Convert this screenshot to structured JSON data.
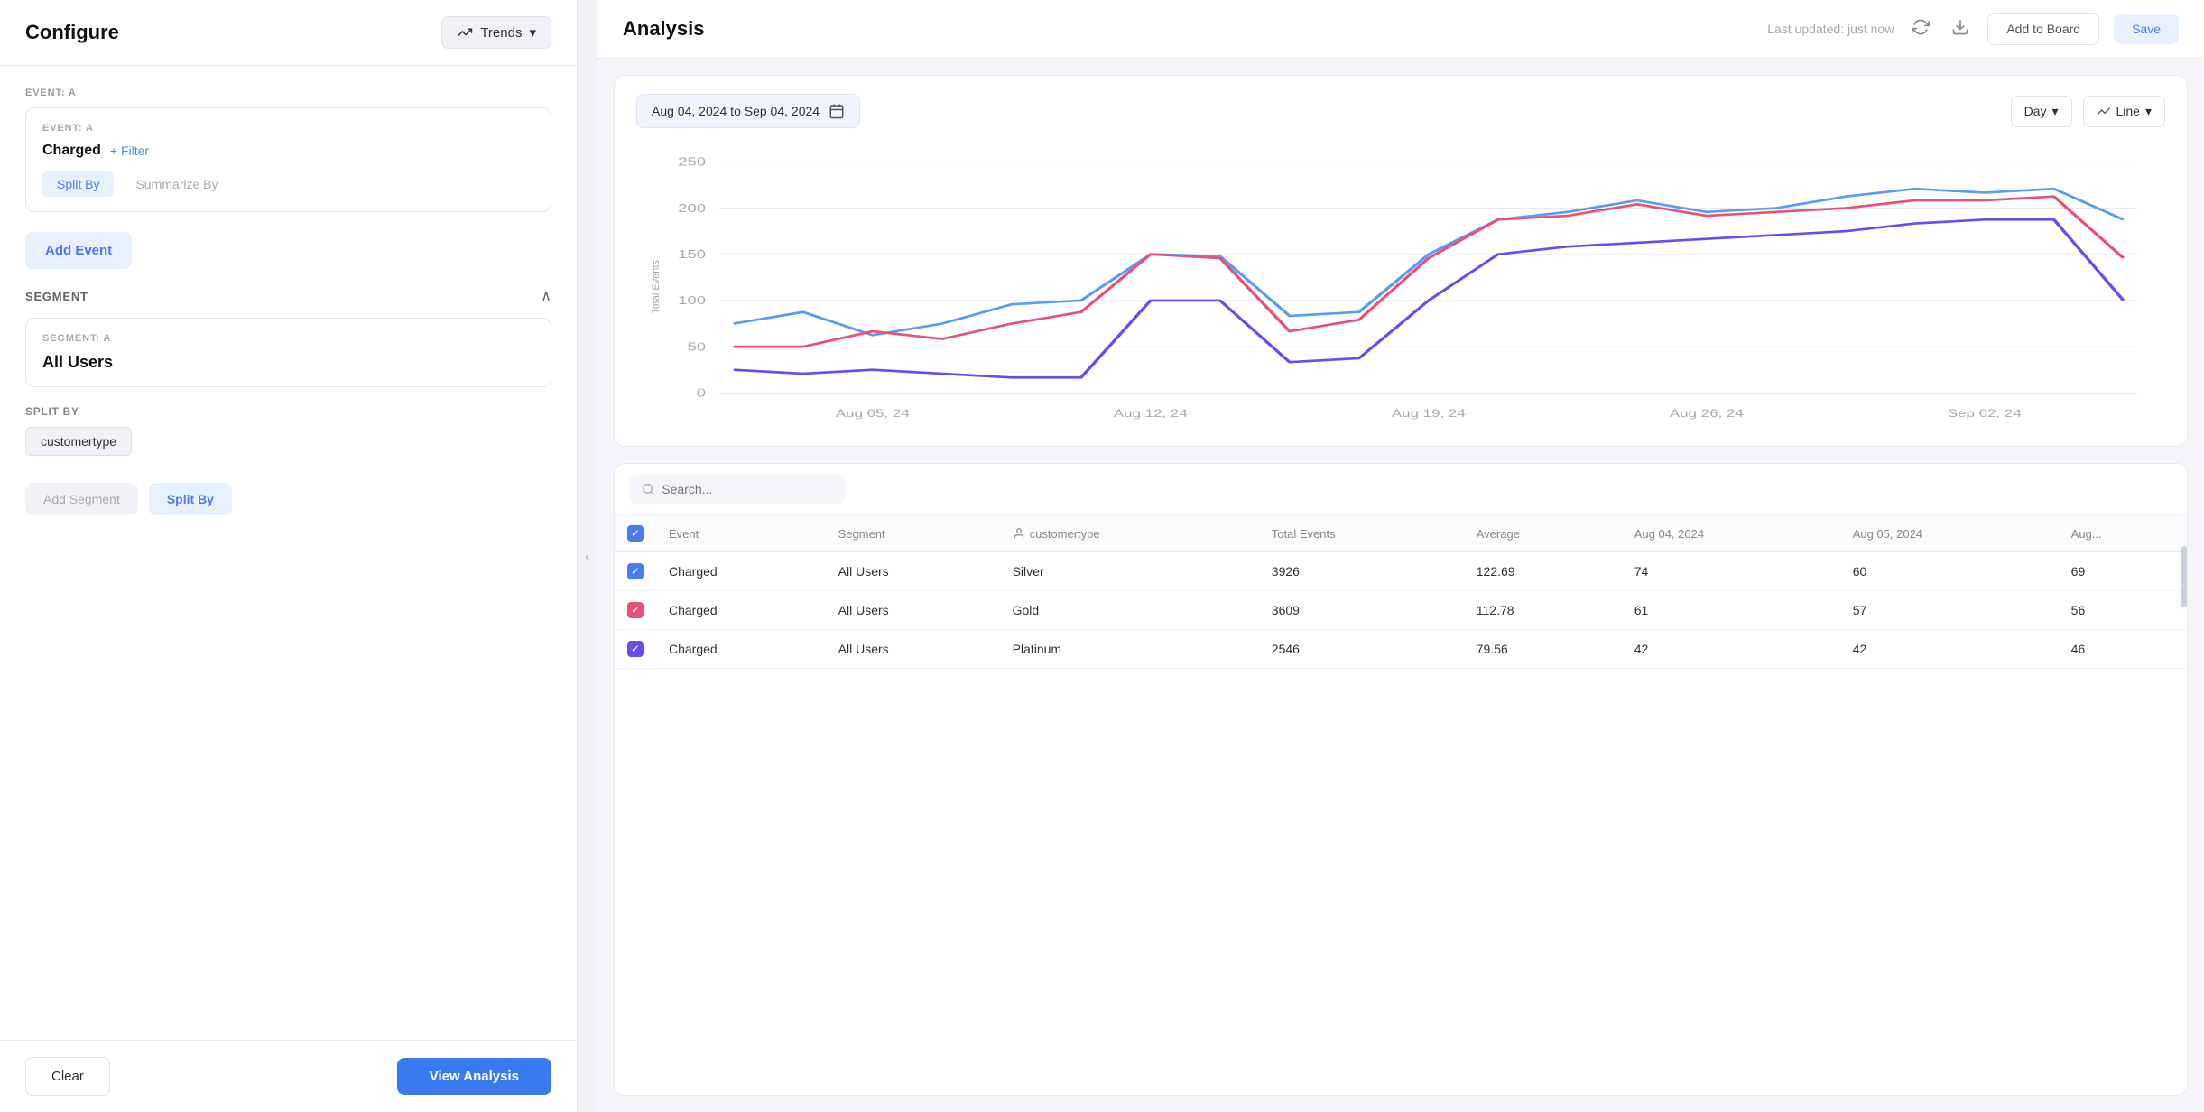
{
  "leftPanel": {
    "title": "Configure",
    "trendsButton": "Trends",
    "eventSection": {
      "label": "EVENT: A",
      "eventName": "Charged",
      "filterLabel": "+ Filter",
      "splitByTab": "Split By",
      "summarizeByTab": "Summarize By"
    },
    "addEventButton": "Add Event",
    "segmentSection": {
      "label": "SEGMENT",
      "segmentA": {
        "label": "SEGMENT: A",
        "name": "All Users"
      }
    },
    "splitBySection": {
      "label": "SPLIT BY",
      "tag": "customertype"
    },
    "addSegmentButton": "Add Segment",
    "splitByButton": "Split By",
    "clearButton": "Clear",
    "viewAnalysisButton": "View Analysis"
  },
  "rightPanel": {
    "title": "Analysis",
    "lastUpdated": "Last updated: just now",
    "addToBoardButton": "Add to Board",
    "saveButton": "Save",
    "dateRange": "Aug 04, 2024 to Sep 04, 2024",
    "granularity": "Day",
    "chartType": "Line",
    "yAxisLabel": "Total Events",
    "yAxisValues": [
      "250",
      "200",
      "150",
      "100",
      "50",
      "0"
    ],
    "xAxisValues": [
      "Aug 05, 24",
      "Aug 12, 24",
      "Aug 19, 24",
      "Aug 26, 24",
      "Sep 02, 24"
    ],
    "searchPlaceholder": "Search...",
    "table": {
      "headers": [
        "Event",
        "Segment",
        "customertype",
        "Total Events",
        "Average",
        "Aug 04, 2024",
        "Aug 05, 2024",
        "Aug..."
      ],
      "rows": [
        {
          "checkColor": "blue",
          "event": "Charged",
          "segment": "All Users",
          "customertype": "Silver",
          "totalEvents": "3926",
          "average": "122.69",
          "aug04": "74",
          "aug05": "60",
          "aug06": "69"
        },
        {
          "checkColor": "pink",
          "event": "Charged",
          "segment": "All Users",
          "customertype": "Gold",
          "totalEvents": "3609",
          "average": "112.78",
          "aug04": "61",
          "aug05": "57",
          "aug06": "56"
        },
        {
          "checkColor": "purple",
          "event": "Charged",
          "segment": "All Users",
          "customertype": "Platinum",
          "totalEvents": "2546",
          "average": "79.56",
          "aug04": "42",
          "aug05": "42",
          "aug06": "46"
        }
      ]
    }
  }
}
